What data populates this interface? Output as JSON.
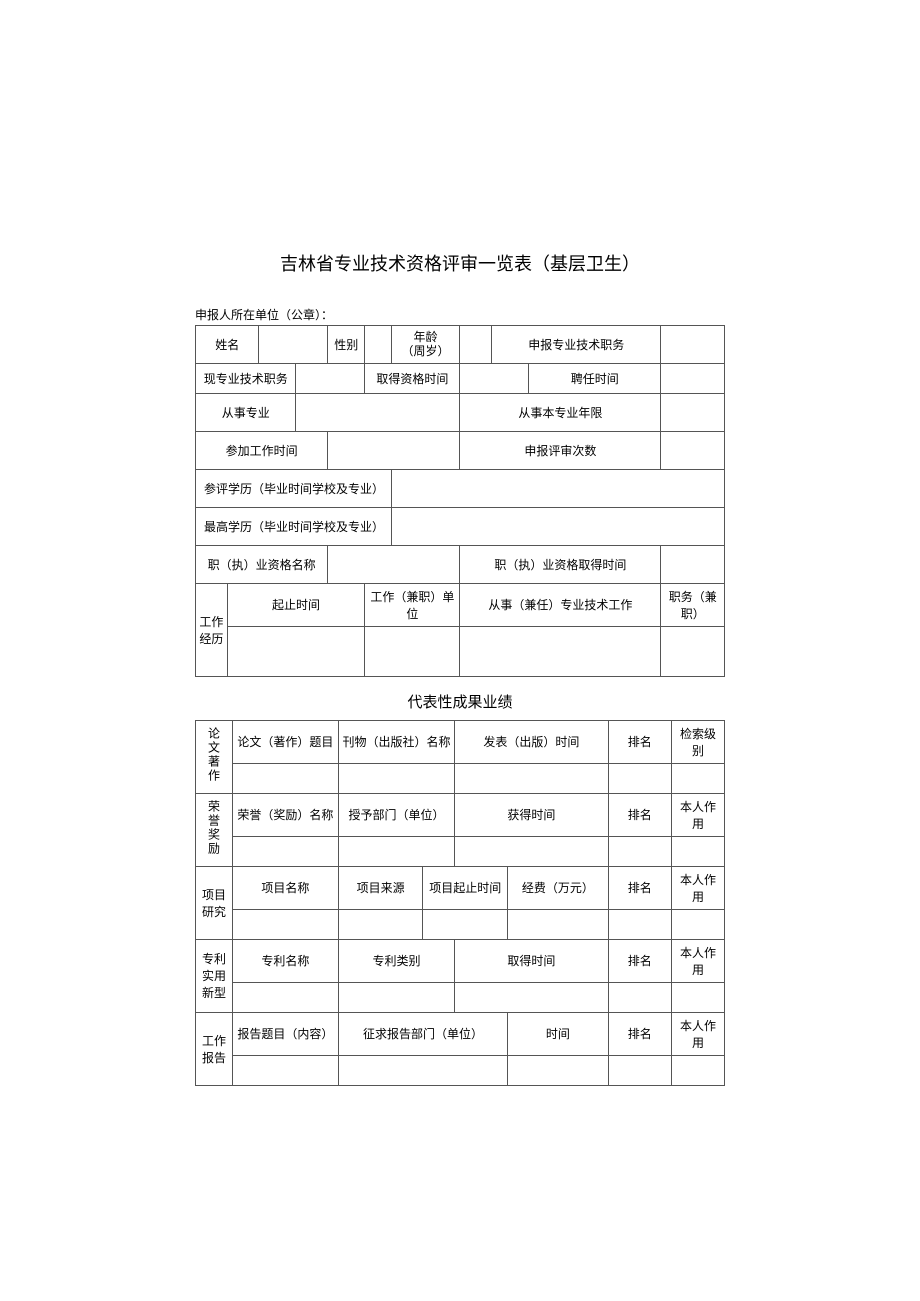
{
  "title": "吉林省专业技术资格评审一览表（基层卫生）",
  "headerLine": "申报人所在单位（公章）：",
  "table1": {
    "row1": {
      "nameLabel": "姓名",
      "nameValue": "",
      "genderLabel": "性别",
      "genderValue": "",
      "ageLabel1": "年龄",
      "ageLabel2": "（周岁）",
      "ageValue": "",
      "applyPositionLabel": "申报专业技术职务",
      "applyPositionValue": ""
    },
    "row2": {
      "currentPositionLabel": "现专业技术职务",
      "currentPositionValue": "",
      "qualTimeLabel": "取得资格时间",
      "qualTimeValue": "",
      "appointTimeLabel": "聘任时间",
      "appointTimeValue": ""
    },
    "row3": {
      "majorLabel": "从事专业",
      "majorValue": "",
      "majorYearsLabel": "从事本专业年限",
      "majorYearsValue": ""
    },
    "row4": {
      "workStartLabel": "参加工作时间",
      "workStartValue": "",
      "reviewCountLabel": "申报评审次数",
      "reviewCountValue": ""
    },
    "row5": {
      "eduReviewLabel": "参评学历（毕业时间学校及专业）",
      "eduReviewValue": ""
    },
    "row6": {
      "eduHighestLabel": "最高学历（毕业时间学校及专业）",
      "eduHighestValue": ""
    },
    "row7": {
      "qualNameLabel": "职（执）业资格名称",
      "qualNameValue": "",
      "qualObtainTimeLabel": "职（执）业资格取得时间",
      "qualObtainTimeValue": ""
    },
    "workHistory": {
      "title": "工作经历",
      "col1": "起止时间",
      "col2": "工作（兼职）单位",
      "col3": "从事（兼任）专业技术工作",
      "col4": "职务（兼职）"
    }
  },
  "sectionHeader": "代表性成果业绩",
  "table2": {
    "papers": {
      "title": "论文著作",
      "col1": "论文（著作）题目",
      "col2": "刊物（出版社）名称",
      "col3": "发表（出版）时间",
      "col4": "排名",
      "col5": "检索级别"
    },
    "honors": {
      "title": "荣誉奖励",
      "col1": "荣誉（奖励）名称",
      "col2": "授予部门（单位）",
      "col3": "获得时间",
      "col4": "排名",
      "col5": "本人作用"
    },
    "projects": {
      "title": "项目研究",
      "col1": "项目名称",
      "col2": "项目来源",
      "col3": "项目起止时间",
      "col4": "经费（万元）",
      "col5": "排名",
      "col6": "本人作用"
    },
    "patents": {
      "title": "专利实用新型",
      "col1": "专利名称",
      "col2": "专利类别",
      "col3": "取得时间",
      "col4": "排名",
      "col5": "本人作用"
    },
    "reports": {
      "title": "工作报告",
      "col1": "报告题目（内容）",
      "col2": "征求报告部门（单位）",
      "col3": "时间",
      "col4": "排名",
      "col5": "本人作用"
    }
  }
}
